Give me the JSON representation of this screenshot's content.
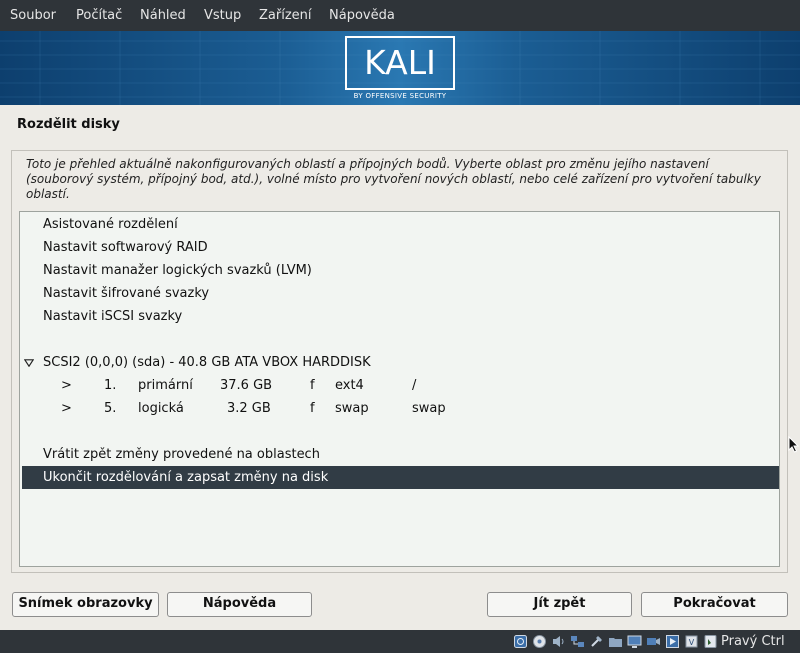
{
  "menubar": {
    "items": [
      "Soubor",
      "Počítač",
      "Náhled",
      "Vstup",
      "Zařízení",
      "Nápověda"
    ]
  },
  "banner": {
    "logo_text": "KALI",
    "logo_subtitle": "BY OFFENSIVE SECURITY"
  },
  "page": {
    "title": "Rozdělit disky",
    "description": "Toto je přehled aktuálně nakonfigurovaných oblastí a přípojných bodů. Vyberte oblast pro změnu jejího nastavení (souborový systém, přípojný bod, atd.), volné místo pro vytvoření nových oblastí, nebo celé zařízení pro vytvoření tabulky oblastí."
  },
  "list": {
    "actions": [
      "Asistované rozdělení",
      "Nastavit softwarový RAID",
      "Nastavit manažer logických svazků (LVM)",
      "Nastavit šifrované svazky",
      "Nastavit iSCSI svazky"
    ],
    "disk": {
      "label": "SCSI2 (0,0,0) (sda) - 40.8 GB ATA VBOX HARDDISK",
      "partitions": [
        {
          "arrow": ">",
          "number": "1.",
          "type": "primární",
          "size": "37.6 GB",
          "flag": "f",
          "fs": "ext4",
          "mount": "/"
        },
        {
          "arrow": ">",
          "number": "5.",
          "type": "logická",
          "size": "3.2 GB",
          "flag": "f",
          "fs": "swap",
          "mount": "swap"
        }
      ]
    },
    "undo_label": "Vrátit zpět změny provedené na oblastech",
    "finish_label": "Ukončit rozdělování a zapsat změny na disk"
  },
  "buttons": {
    "screenshot": "Snímek obrazovky",
    "help": "Nápověda",
    "back": "Jít zpět",
    "continue": "Pokračovat"
  },
  "statusbar": {
    "host_key": "Pravý Ctrl",
    "icons": [
      "hard-disk-icon",
      "optical-drive-icon",
      "audio-icon",
      "network-icon",
      "usb-icon",
      "shared-folder-icon",
      "display-icon",
      "video-capture-icon",
      "recording-icon",
      "cpu-icon",
      "mouse-integration-icon",
      "host-key-arrow-icon"
    ]
  },
  "colors": {
    "selection": "#313c45",
    "banner": "#1b5d93",
    "chrome": "#2f3439"
  }
}
